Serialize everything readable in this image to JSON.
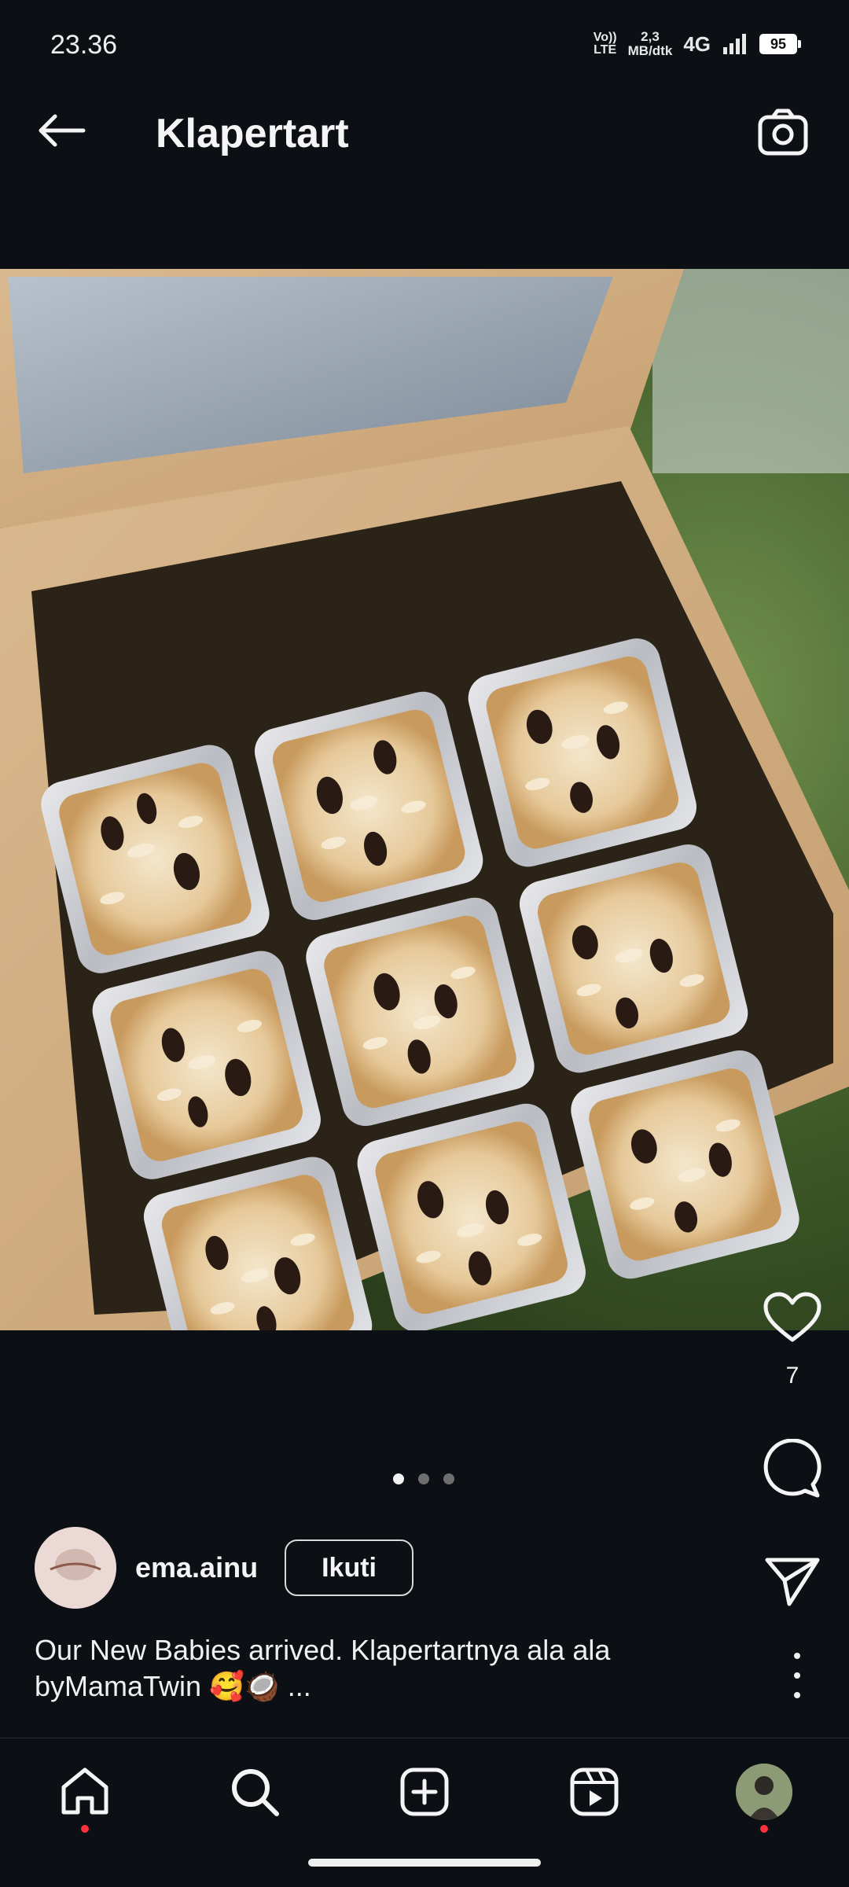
{
  "status_bar": {
    "time": "23.36",
    "volte_top": "Vo))",
    "volte_bottom": "LTE",
    "speed_value": "2,3",
    "speed_unit": "MB/dtk",
    "network": "4G",
    "battery": "95"
  },
  "header": {
    "title": "Klapertart",
    "back_icon": "arrow-left-icon",
    "camera_icon": "camera-icon"
  },
  "post": {
    "image_description_icon": "photo",
    "like_count": "7",
    "carousel": {
      "count": 3,
      "active_index": 0
    },
    "author": {
      "username": "ema.ainu",
      "follow_label": "Ikuti"
    },
    "caption_line1": "Our New Babies arrived. Klapertartnya ala ala",
    "caption_line2": "byMamaTwin 🥰🥥 ..."
  },
  "bottom_nav": {
    "items": [
      "home-icon",
      "search-icon",
      "add-post-icon",
      "reels-icon",
      "profile-avatar"
    ]
  },
  "colors": {
    "background": "#0c1014",
    "text": "#f5f5f5",
    "notification": "#ff3040"
  }
}
